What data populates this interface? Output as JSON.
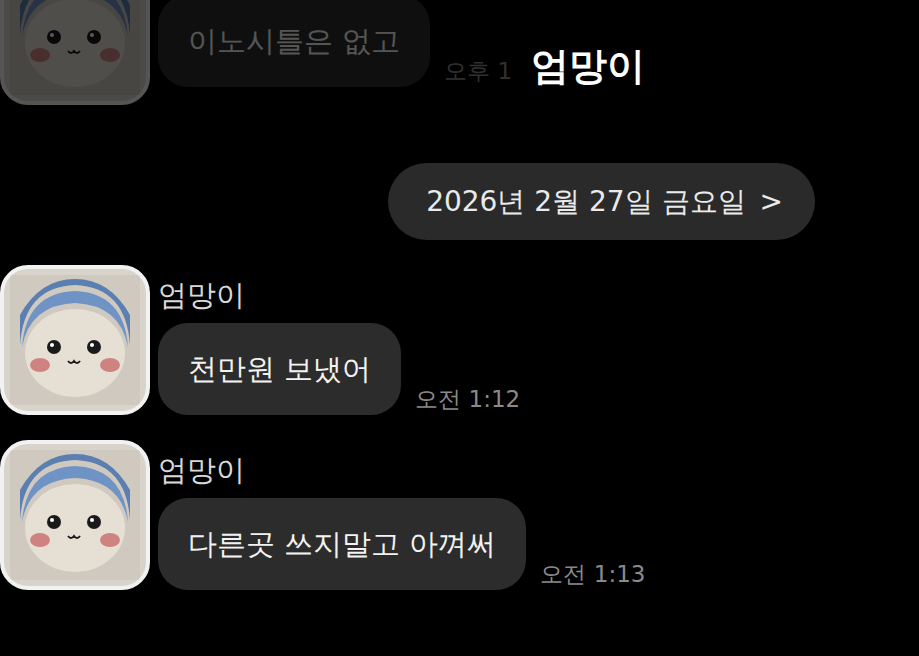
{
  "window": {
    "title": "엄망이"
  },
  "previous_message": {
    "text": "이노시틀은 없고",
    "time": "오후 1",
    "dimmed": true
  },
  "date_divider": {
    "label": "2026년 2월 27일 금요일",
    "chevron": ">"
  },
  "messages": [
    {
      "sender": "엄망이",
      "text": "천만원 보냈어",
      "time": "오전 1:12"
    },
    {
      "sender": "엄망이",
      "text": "다른곳 쓰지말고 아껴써",
      "time": "오전 1:13"
    }
  ]
}
